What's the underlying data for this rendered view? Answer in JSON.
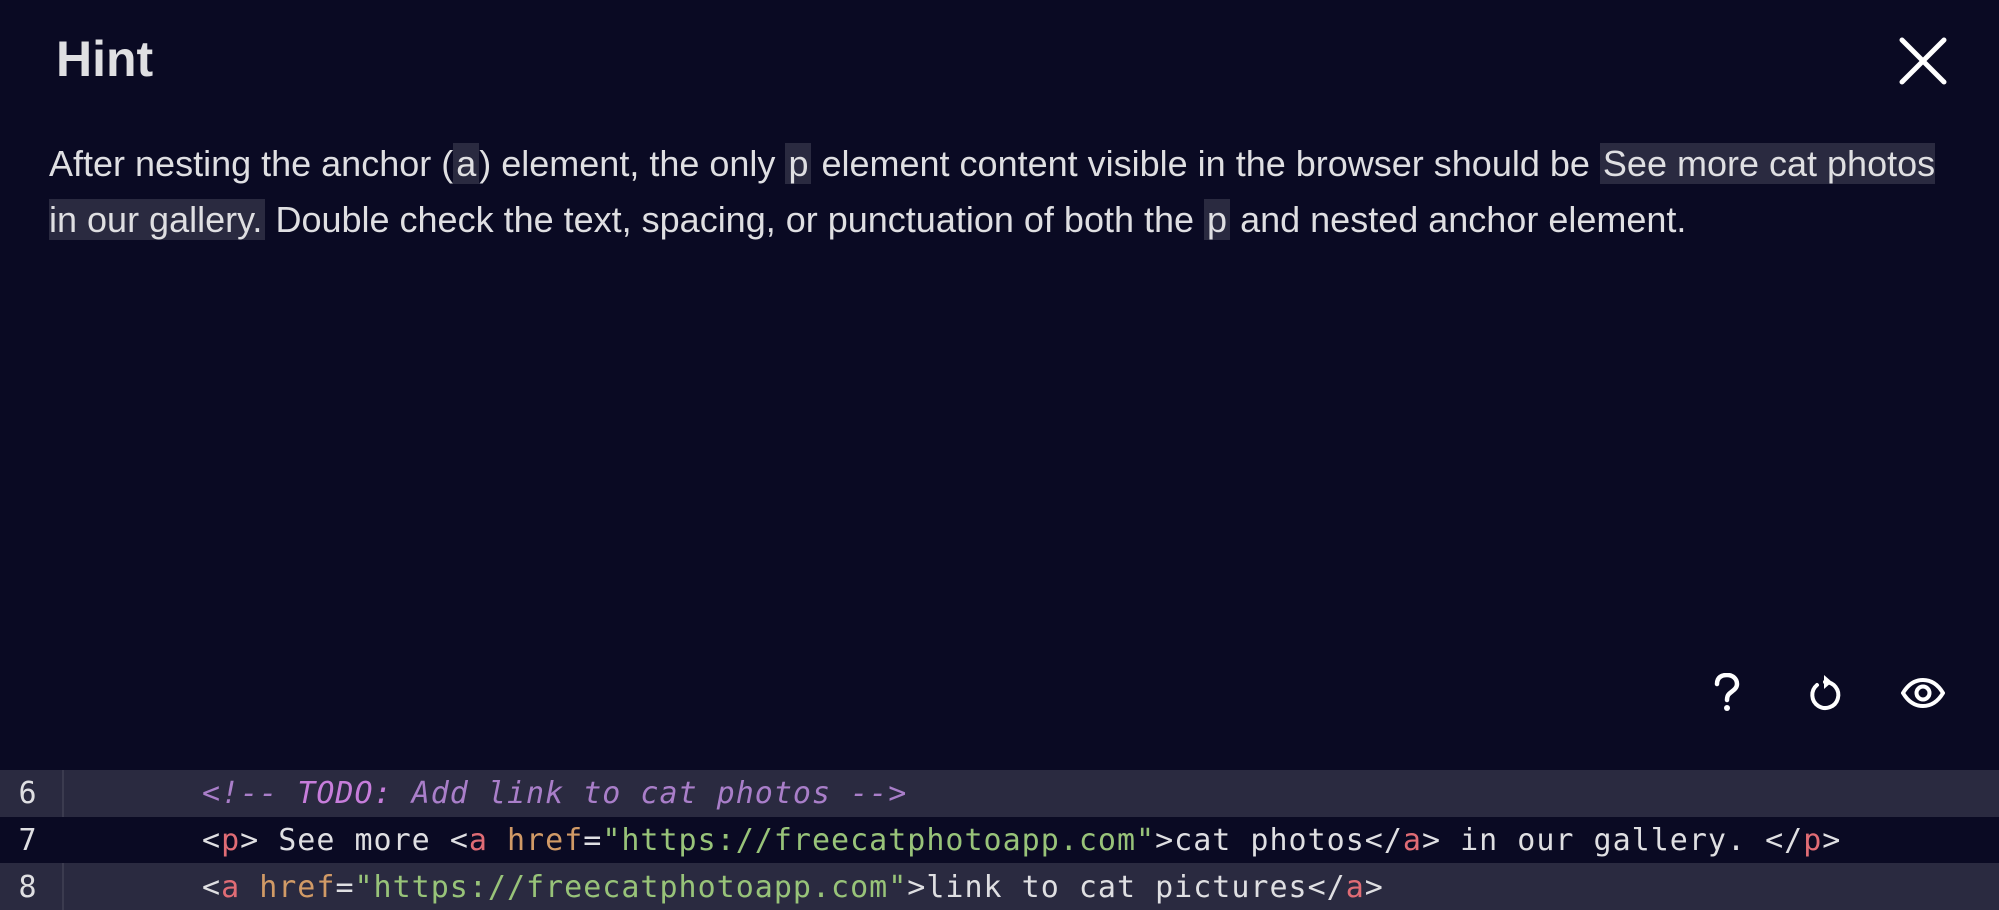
{
  "dialog": {
    "title": "Hint",
    "body": {
      "p1": "After nesting the anchor (",
      "code1": "a",
      "p2": ") element, the only ",
      "code2": "p",
      "p3": " element content visible in the browser should be ",
      "code3": "See more cat photos in our gallery.",
      "p4": " Double check the text, spacing, or punctuation of both the ",
      "code4": "p",
      "p5": " and nested anchor element."
    }
  },
  "toolbar": {
    "help_icon": "question-mark",
    "reset_icon": "reset",
    "preview_icon": "eye"
  },
  "editor": {
    "lines": [
      {
        "number": "6",
        "indent": "        ",
        "comment_open": "<!-- ",
        "comment_todo": "TODO:",
        "comment_text": " Add link to cat photos ",
        "comment_close": "-->"
      },
      {
        "number": "7",
        "lt1": "<",
        "tag_p": "p",
        "gt1": ">",
        "text1": " See more ",
        "lt2": "<",
        "tag_a": "a",
        "sp": " ",
        "attr": "href",
        "eq": "=",
        "val": "\"https://freecatphotoapp.com\"",
        "gt2": ">",
        "text2": "cat photos",
        "lt3": "</",
        "tag_a_close": "a",
        "gt3": ">",
        "text3": " in our gallery. ",
        "lt4": "</",
        "tag_p_close": "p",
        "gt4": ">"
      },
      {
        "number": "8",
        "lt1": "<",
        "tag_a": "a",
        "sp": " ",
        "attr": "href",
        "eq": "=",
        "val": "\"https://freecatphotoapp.com\"",
        "gt1": ">",
        "text": "link to cat pictures",
        "lt2": "</",
        "tag_a_close": "a",
        "gt2": ">"
      }
    ]
  },
  "colors": {
    "background": "#0a0a23",
    "editor_bg": "#2a2a40",
    "text": "#dfdfe2"
  }
}
